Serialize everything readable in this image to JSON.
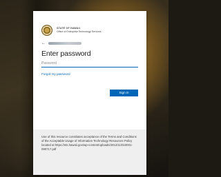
{
  "org": {
    "line1": "STATE OF HAWAII",
    "line2": "Office of Enterprise Technology Services"
  },
  "account": {
    "email_display": ""
  },
  "login": {
    "heading": "Enter password",
    "password_placeholder": "Password",
    "forgot_link": "Forgot my password",
    "signin_button": "Sign in"
  },
  "footer": {
    "notice": "Use of this resource constitutes acceptance of the Terms and Conditions of the Acceptable Usage of Information Technology Resources Policy located at https://ets.hawaii.gov/wp-content/uploads/2012/11/010001-090717.pdf"
  },
  "colors": {
    "accent": "#0067b8",
    "footer_bg": "#efefef"
  },
  "icons": {
    "back": "arrow-left-icon",
    "seal": "state-seal-icon"
  }
}
